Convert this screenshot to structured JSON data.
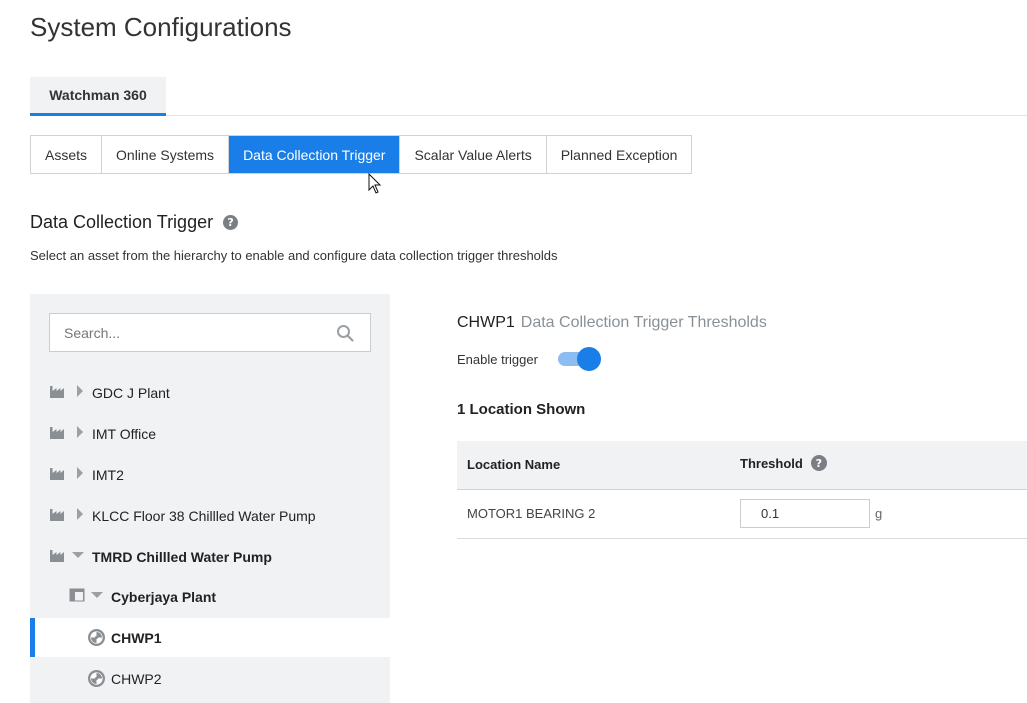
{
  "page": {
    "title": "System Configurations"
  },
  "top_tabs": [
    {
      "label": "Watchman 360",
      "active": true
    }
  ],
  "sub_tabs": [
    {
      "label": "Assets",
      "active": false
    },
    {
      "label": "Online Systems",
      "active": false
    },
    {
      "label": "Data Collection Trigger",
      "active": true
    },
    {
      "label": "Scalar Value Alerts",
      "active": false
    },
    {
      "label": "Planned Exception",
      "active": false
    }
  ],
  "section": {
    "title": "Data Collection Trigger",
    "help_glyph": "?",
    "description": "Select an asset from the hierarchy to enable and configure data collection trigger thresholds"
  },
  "tree": {
    "search_placeholder": "Search...",
    "items": [
      {
        "label": "GDC J Plant",
        "icon": "plant-icon",
        "expander": "caret-right-icon",
        "bold": false,
        "selected": false
      },
      {
        "label": "IMT Office",
        "icon": "plant-icon",
        "expander": "caret-right-icon",
        "bold": false,
        "selected": false
      },
      {
        "label": "IMT2",
        "icon": "plant-icon",
        "expander": "caret-right-icon",
        "bold": false,
        "selected": false
      },
      {
        "label": "KLCC Floor 38 Chillled Water Pump",
        "icon": "plant-icon",
        "expander": "caret-right-icon",
        "bold": false,
        "selected": false
      },
      {
        "label": "TMRD Chillled Water Pump",
        "icon": "plant-icon",
        "expander": "caret-down-icon",
        "bold": true,
        "selected": false
      },
      {
        "label": "Cyberjaya Plant",
        "icon": "area-icon",
        "expander": "caret-down-icon",
        "bold": true,
        "selected": false
      },
      {
        "label": "CHWP1",
        "icon": "asset-icon",
        "expander": "",
        "bold": true,
        "selected": true
      },
      {
        "label": "CHWP2",
        "icon": "asset-icon",
        "expander": "",
        "bold": false,
        "selected": false
      }
    ]
  },
  "detail": {
    "asset_name": "CHWP1",
    "header_sub": "Data Collection Trigger Thresholds",
    "enable_label": "Enable trigger",
    "enabled": true,
    "location_count_label": "1 Location Shown",
    "table": {
      "col_location": "Location Name",
      "col_threshold": "Threshold",
      "rows": [
        {
          "location": "MOTOR1 BEARING 2",
          "threshold": "0.1",
          "unit": "g"
        }
      ]
    }
  },
  "colors": {
    "accent": "#1a7ee8",
    "toggle_track": "#8cbdf0",
    "panel_bg": "#f1f2f3",
    "muted_text": "#8a9196"
  }
}
